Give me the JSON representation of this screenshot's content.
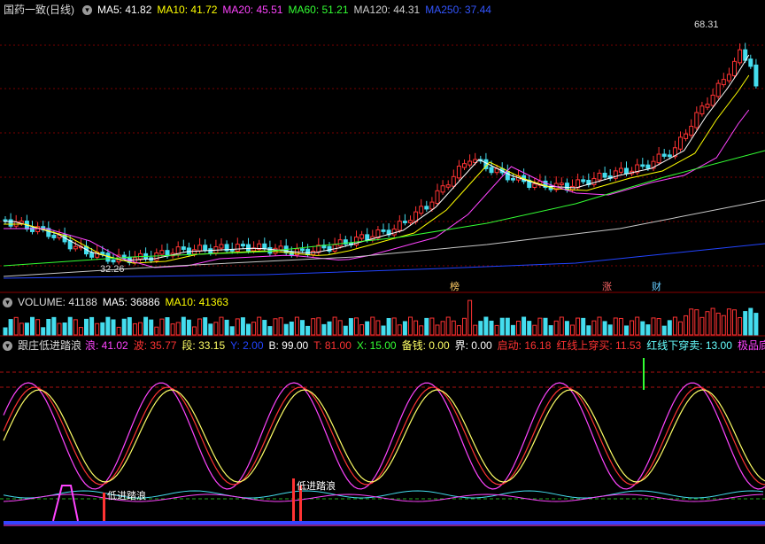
{
  "main_legend": {
    "title": "国药一致(日线)",
    "ma5": "MA5: 41.82",
    "ma10": "MA10: 41.72",
    "ma20": "MA20: 45.51",
    "ma60": "MA60: 51.21",
    "ma120": "MA120: 44.31",
    "ma250": "MA250: 37.44",
    "colors": {
      "ma5": "#ffffff",
      "ma10": "#ffff00",
      "ma20": "#ff00ff",
      "ma60": "#00ff00",
      "ma120": "#c8c8c8",
      "ma250": "#2040ff"
    }
  },
  "price_labels": {
    "high": "68.31",
    "low": "32.26"
  },
  "markers": {
    "bang": "榜",
    "zhang": "涨",
    "cai": "财"
  },
  "volume_legend": {
    "volume": "VOLUME: 41188",
    "ma5": "MA5: 36886",
    "ma10": "MA10: 41363"
  },
  "indicator_legend": {
    "name": "跟庄低进踏浪",
    "lang": "浪: 41.02",
    "bo": "波: 35.77",
    "duan": "段: 33.15",
    "y": "Y: 2.00",
    "b": "B: 99.00",
    "t": "T: 81.00",
    "x": "X: 15.00",
    "beiqian": "备钱: 0.00",
    "jie": "界: 0.00",
    "qidong": "启动: 16.18",
    "hongshang": "红线上穿买: 11.53",
    "hongxia": "红线下穿卖: 13.00",
    "jipin": "极品底"
  },
  "indicator_labels": {
    "signal1": "低进踏浪",
    "signal2": "低进踏浪"
  }
}
